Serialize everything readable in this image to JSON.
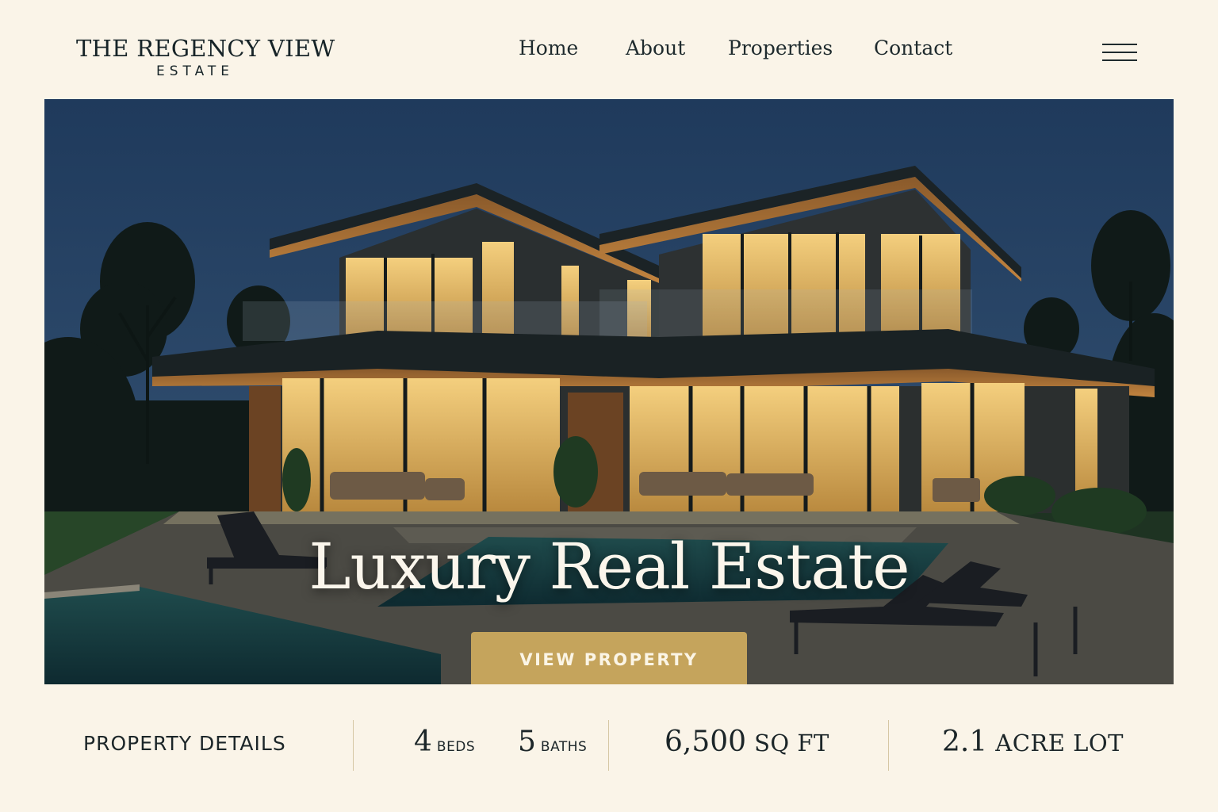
{
  "brand": {
    "title": "THE REGENCY VIEW",
    "subtitle": "ESTATE"
  },
  "nav": {
    "items": [
      {
        "label": "Home"
      },
      {
        "label": "About"
      },
      {
        "label": "Properties"
      },
      {
        "label": "Contact"
      }
    ],
    "menu_icon": "hamburger-menu-icon"
  },
  "hero": {
    "title": "Luxury Real Estate",
    "cta_label": "VIEW PROPERTY",
    "image": "modern-luxury-house-at-dusk"
  },
  "details": {
    "label": "PROPERTY DETAILS",
    "beds": {
      "value": "4",
      "unit": "BEDS"
    },
    "baths": {
      "value": "5",
      "unit": "BATHS"
    },
    "area": {
      "value": "6,500",
      "unit": "SQ FT"
    },
    "lot": {
      "value": "2.1",
      "unit": "ACRE LOT"
    }
  },
  "colors": {
    "background": "#faf4e8",
    "accent_gold": "#c5a45c",
    "text_dark": "#1c2629",
    "sky": "#1d3656"
  }
}
